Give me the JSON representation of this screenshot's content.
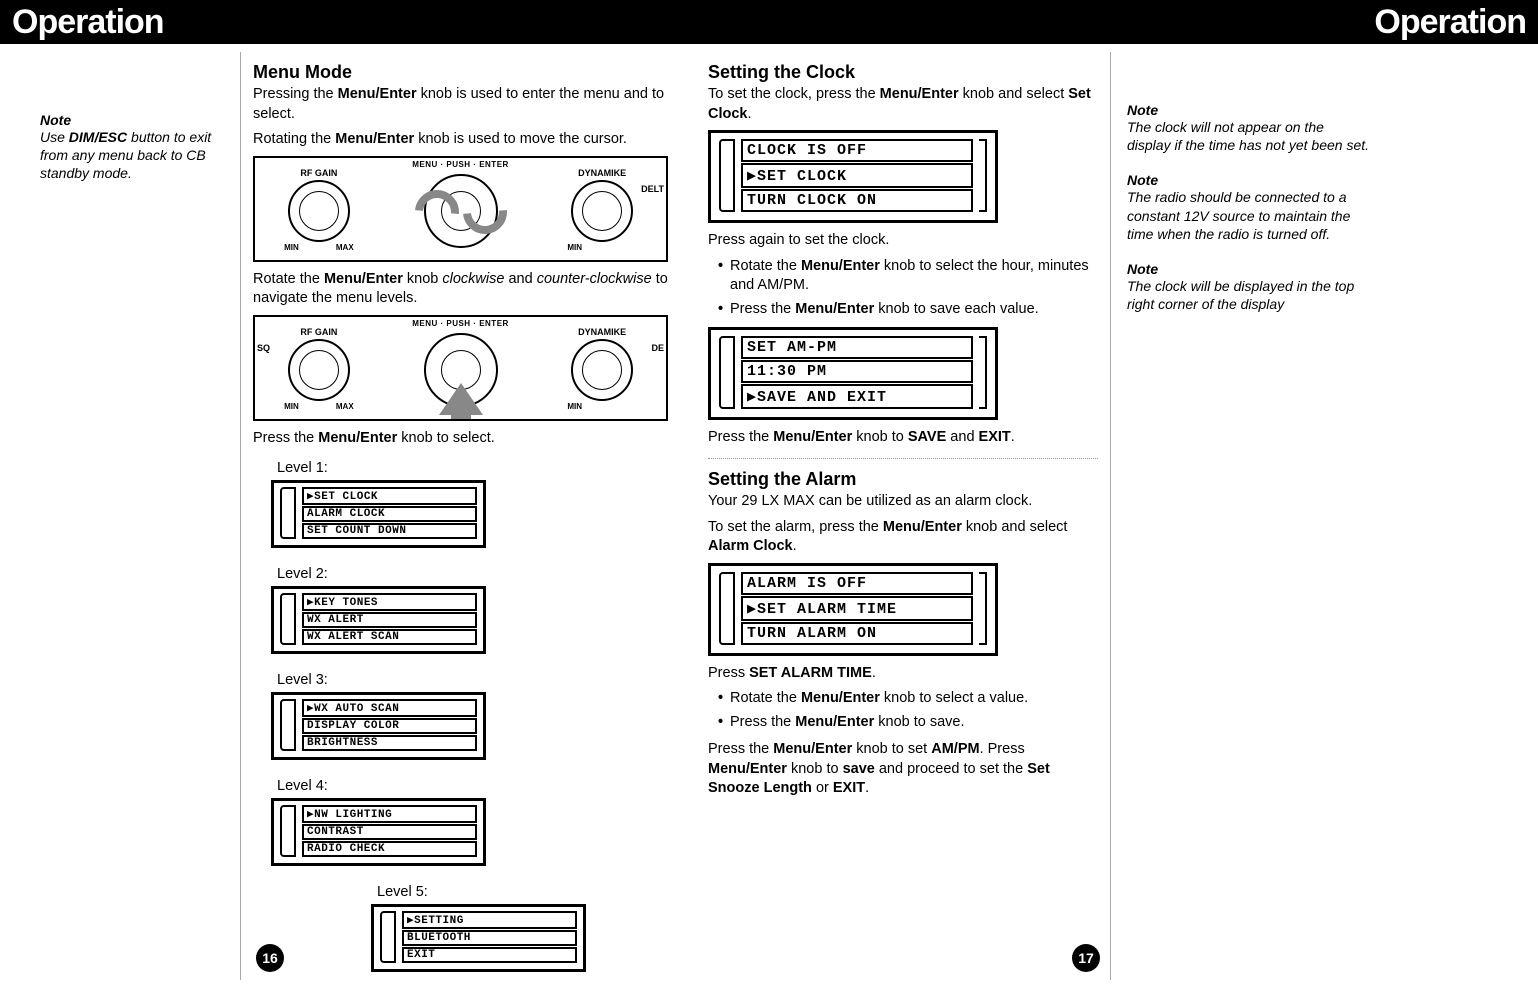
{
  "header": {
    "left": "Operation",
    "right": "Operation"
  },
  "sidebar_left": {
    "note": {
      "title": "Note",
      "text_parts": [
        "Use ",
        "DIM/ESC",
        " button to exit from any menu back to CB standby mode."
      ]
    }
  },
  "menu_mode": {
    "heading": "Menu Mode",
    "p1_parts": [
      "Pressing the ",
      "Menu/Enter",
      " knob is used to enter the menu and to select."
    ],
    "p2_parts": [
      "Rotating the ",
      "Menu/Enter",
      " knob is used to move the cursor."
    ],
    "panel_top": "MENU · PUSH · ENTER",
    "knob_labels": {
      "sq": "SQ",
      "rfgain": "RF GAIN",
      "dynamike": "DYNAMIKE",
      "delta": "DELT",
      "de": "DE",
      "min": "MIN",
      "max": "MAX"
    },
    "p3_parts": [
      "Rotate the ",
      "Menu/Enter",
      " knob ",
      "clockwise",
      " and ",
      "counter-clockwise",
      " to navigate the menu levels."
    ],
    "p4_parts": [
      "Press the ",
      "Menu/Enter",
      " knob to select."
    ]
  },
  "levels": {
    "label_prefix": "Level",
    "l1": [
      "▶SET CLOCK",
      " ALARM CLOCK",
      " SET COUNT DOWN"
    ],
    "l2": [
      "▶KEY TONES",
      " WX ALERT",
      " WX ALERT SCAN"
    ],
    "l3": [
      "▶WX AUTO SCAN",
      " DISPLAY COLOR",
      " BRIGHTNESS"
    ],
    "l4": [
      "▶NW LIGHTING",
      " CONTRAST",
      " RADIO CHECK"
    ],
    "l5": [
      "▶SETTING",
      " BLUETOOTH",
      " EXIT"
    ]
  },
  "clock": {
    "heading": "Setting the Clock",
    "p1_parts": [
      "To set the clock, press the ",
      "Menu/Enter",
      " knob and select ",
      "Set Clock",
      "."
    ],
    "lcd1": [
      " CLOCK IS OFF",
      "▶SET CLOCK",
      " TURN CLOCK ON"
    ],
    "p2": "Press again to set the clock.",
    "li1_parts": [
      "Rotate the ",
      "Menu/Enter",
      " knob to select the hour, minutes and AM/PM."
    ],
    "li2_parts": [
      "Press the ",
      "Menu/Enter",
      "  knob to save each value."
    ],
    "lcd2": [
      " SET AM-PM",
      " 11:30 PM",
      "▶SAVE AND EXIT"
    ],
    "p3_parts": [
      "Press the ",
      "Menu/Enter",
      " knob to ",
      "SAVE",
      " and ",
      "EXIT",
      "."
    ]
  },
  "alarm": {
    "heading": "Setting the Alarm",
    "p1": "Your 29 LX MAX can be utilized as an alarm clock.",
    "p2_parts": [
      "To set the alarm, press the ",
      "Menu/Enter",
      " knob and select ",
      "Alarm Clock",
      "."
    ],
    "lcd": [
      " ALARM IS OFF",
      "▶SET ALARM TIME",
      " TURN ALARM ON"
    ],
    "p3_parts": [
      "Press ",
      "SET ALARM TIME",
      "."
    ],
    "li1_parts": [
      "Rotate the ",
      "Menu/Enter",
      " knob to select a value."
    ],
    "li2_parts": [
      "Press the ",
      "Menu/Enter",
      "  knob to save."
    ],
    "p4_parts": [
      "Press the ",
      "Menu/Enter",
      " knob to set ",
      "AM/PM",
      ". Press ",
      "Menu/Enter",
      " knob to ",
      "save",
      " and proceed to set the ",
      "Set Snooze Length",
      " or ",
      "EXIT",
      "."
    ]
  },
  "sidebar_right": {
    "n1": {
      "title": "Note",
      "text": "The clock will not appear on the display if the time has not yet been set."
    },
    "n2": {
      "title": "Note",
      "text": "The radio should be connected to a constant 12V source to maintain the time when the radio is turned off."
    },
    "n3": {
      "title": "Note",
      "text": "The clock will be displayed in the top right corner of the display"
    }
  },
  "page_numbers": {
    "left": "16",
    "right": "17"
  }
}
